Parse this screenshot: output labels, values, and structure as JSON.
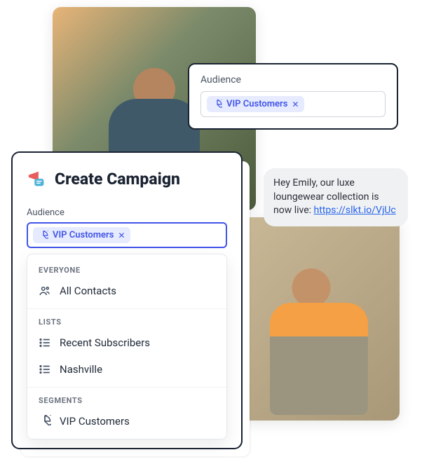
{
  "audience_card": {
    "label": "Audience",
    "chip_label": "VIP Customers"
  },
  "chat": {
    "text_pre": "Hey Emily, our luxe loungewear collection is now live: ",
    "link_text": "https://slkt.io/VjUc"
  },
  "panel": {
    "title": "Create Campaign",
    "field_label": "Audience",
    "chip_label": "VIP Customers"
  },
  "dropdown": {
    "section_everyone": "EVERYONE",
    "item_all_contacts": "All Contacts",
    "section_lists": "LISTS",
    "item_recent_subscribers": "Recent Subscribers",
    "item_nashville": "Nashville",
    "section_segments": "SEGMENTS",
    "item_vip_customers": "VIP Customers"
  }
}
